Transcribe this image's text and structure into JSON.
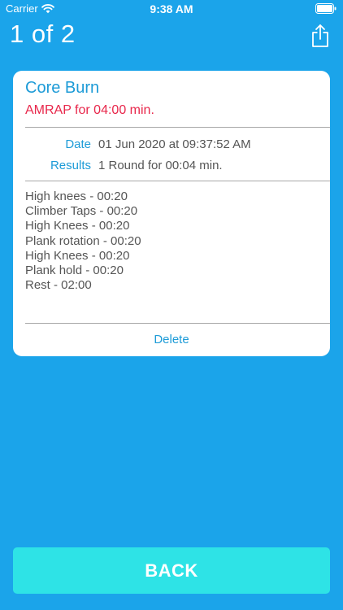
{
  "status_bar": {
    "carrier": "Carrier",
    "time": "9:38 AM"
  },
  "nav": {
    "page_counter": "1 of 2",
    "share_icon": "share-icon"
  },
  "workout": {
    "title": "Core Burn",
    "type": "AMRAP for 04:00 min.",
    "date_label": "Date",
    "date_value": "01 Jun 2020 at 09:37:52 AM",
    "results_label": "Results",
    "results_value": "1 Round for 00:04 min.",
    "exercises": [
      "High knees - 00:20",
      "Climber Taps - 00:20",
      "High Knees - 00:20",
      "Plank rotation - 00:20",
      "High Knees - 00:20",
      "Plank hold - 00:20",
      "Rest - 02:00"
    ],
    "delete_label": "Delete"
  },
  "back_label": "BACK",
  "colors": {
    "background": "#1ba4ea",
    "accent": "#1d9bd7",
    "alert": "#e8274b",
    "back_button": "#2ee3e6"
  }
}
